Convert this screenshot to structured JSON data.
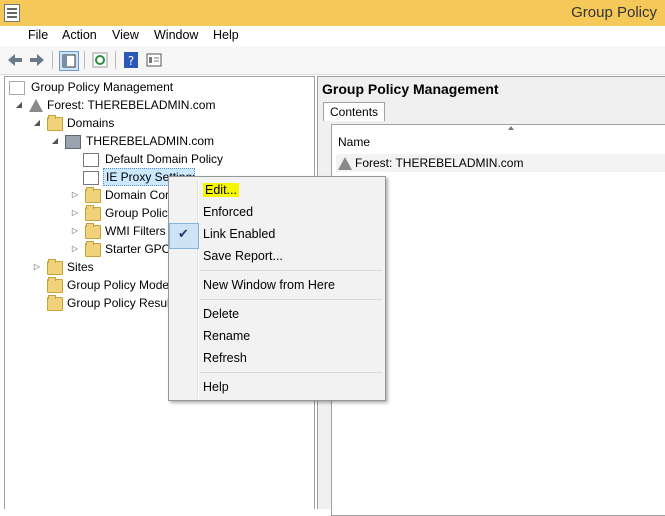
{
  "window": {
    "title": "Group Policy"
  },
  "menu": [
    "File",
    "Action",
    "View",
    "Window",
    "Help"
  ],
  "tree": {
    "root": "Group Policy Management",
    "forest": "Forest: THEREBELADMIN.com",
    "domains": "Domains",
    "domain": "THEREBELADMIN.com",
    "default_policy": "Default Domain Policy",
    "ie_proxy": "IE Proxy Settings",
    "domain_controllers": "Domain Cor",
    "group_policy_objects": "Group Policy",
    "wmi_filters": "WMI Filters",
    "starter_gpos": "Starter GPOs",
    "sites": "Sites",
    "modeling": "Group Policy Mode",
    "results": "Group Policy Result"
  },
  "right": {
    "title": "Group Policy Management",
    "tab": "Contents",
    "column": "Name",
    "row": "Forest: THEREBELADMIN.com"
  },
  "context_menu": {
    "edit": "Edit...",
    "enforced": "Enforced",
    "link_enabled": "Link Enabled",
    "save_report": "Save Report...",
    "new_window": "New Window from Here",
    "delete": "Delete",
    "rename": "Rename",
    "refresh": "Refresh",
    "help": "Help",
    "check_mark": "✔"
  },
  "colors": {
    "titlebar": "#f5c85a",
    "highlight": "#f6f600",
    "selection": "#cce8ff"
  }
}
